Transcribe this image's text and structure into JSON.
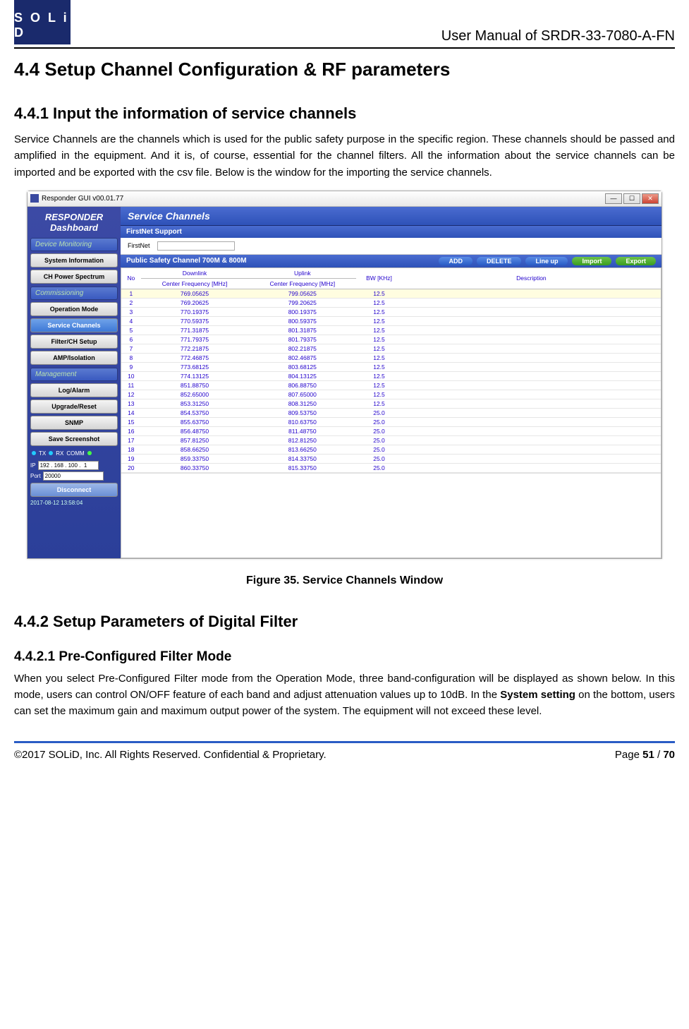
{
  "header": {
    "logo": "S O L i D",
    "right": "User Manual of SRDR-33-7080-A-FN"
  },
  "h1": "4.4   Setup Channel Configuration & RF parameters",
  "s441": {
    "title": "4.4.1 Input the information of service channels",
    "para": "Service Channels are the channels which is used for the public safety purpose in the specific region. These channels should be passed and amplified in the equipment. And it is, of course, essential for the channel filters. All the information about the service channels can be imported and be exported with the csv file. Below is the window for the importing the service channels."
  },
  "fig_caption": "Figure 35. Service Channels Window",
  "s442": {
    "title": "4.4.2 Setup Parameters of Digital Filter",
    "sub1_title": "4.4.2.1  Pre-Configured Filter Mode",
    "sub1_para_a": "When you select Pre-Configured Filter mode from the Operation Mode, three band-configuration will be displayed as shown below. In this mode, users can control ON/OFF feature of each band and adjust attenuation values up to 10dB. In the ",
    "sub1_para_bold": "System setting",
    "sub1_para_b": " on the bottom, users can set the maximum gain and maximum output power of the system. The equipment will not exceed these level."
  },
  "footer": {
    "left": "©2017 SOLiD, Inc. All Rights Reserved. Confidential & Proprietary.",
    "right_a": "Page ",
    "right_b": "51",
    "right_c": " / ",
    "right_d": "70"
  },
  "window": {
    "title": "Responder GUI v00.01.77",
    "sidebar": {
      "title_a": "RESPONDER",
      "title_b": "Dashboard",
      "grp1": "Device Monitoring",
      "btns1": [
        "System Information",
        "CH Power Spectrum"
      ],
      "grp2": "Commissioning",
      "btns2": [
        "Operation Mode",
        "Service Channels",
        "Filter/CH Setup",
        "AMP/Isolation"
      ],
      "grp3": "Management",
      "btns3": [
        "Log/Alarm",
        "Upgrade/Reset",
        "SNMP",
        "Save Screenshot"
      ],
      "tx": "TX",
      "rx": "RX",
      "comm": "COMM",
      "ip_label": "IP",
      "ip_value": "192 . 168 . 100 .  1",
      "port_label": "Port",
      "port_value": "20000",
      "disconnect": "Disconnect",
      "timestamp": "2017-08-12 13:58:04"
    },
    "main": {
      "panel_title": "Service Channels",
      "firstnet_hdr": "FirstNet Support",
      "firstnet_label": "FirstNet",
      "safety_hdr": "Public Safety Channel 700M & 800M",
      "btn_add": "ADD",
      "btn_del": "DELETE",
      "btn_line": "Line up",
      "btn_imp": "Import",
      "btn_exp": "Export",
      "th_no": "No",
      "th_dl": "Downlink",
      "th_ul": "Uplink",
      "th_cf": "Center Frequency [MHz]",
      "th_bw": "BW [KHz]",
      "th_desc": "Description"
    }
  },
  "chart_data": {
    "type": "table",
    "columns": [
      "No",
      "Downlink Center Frequency [MHz]",
      "Uplink Center Frequency [MHz]",
      "BW [KHz]",
      "Description"
    ],
    "rows": [
      [
        1,
        "769.05625",
        "799.05625",
        "12.5",
        ""
      ],
      [
        2,
        "769.20625",
        "799.20625",
        "12.5",
        ""
      ],
      [
        3,
        "770.19375",
        "800.19375",
        "12.5",
        ""
      ],
      [
        4,
        "770.59375",
        "800.59375",
        "12.5",
        ""
      ],
      [
        5,
        "771.31875",
        "801.31875",
        "12.5",
        ""
      ],
      [
        6,
        "771.79375",
        "801.79375",
        "12.5",
        ""
      ],
      [
        7,
        "772.21875",
        "802.21875",
        "12.5",
        ""
      ],
      [
        8,
        "772.46875",
        "802.46875",
        "12.5",
        ""
      ],
      [
        9,
        "773.68125",
        "803.68125",
        "12.5",
        ""
      ],
      [
        10,
        "774.13125",
        "804.13125",
        "12.5",
        ""
      ],
      [
        11,
        "851.88750",
        "806.88750",
        "12.5",
        ""
      ],
      [
        12,
        "852.65000",
        "807.65000",
        "12.5",
        ""
      ],
      [
        13,
        "853.31250",
        "808.31250",
        "12.5",
        ""
      ],
      [
        14,
        "854.53750",
        "809.53750",
        "25.0",
        ""
      ],
      [
        15,
        "855.63750",
        "810.63750",
        "25.0",
        ""
      ],
      [
        16,
        "856.48750",
        "811.48750",
        "25.0",
        ""
      ],
      [
        17,
        "857.81250",
        "812.81250",
        "25.0",
        ""
      ],
      [
        18,
        "858.66250",
        "813.66250",
        "25.0",
        ""
      ],
      [
        19,
        "859.33750",
        "814.33750",
        "25.0",
        ""
      ],
      [
        20,
        "860.33750",
        "815.33750",
        "25.0",
        ""
      ]
    ]
  }
}
